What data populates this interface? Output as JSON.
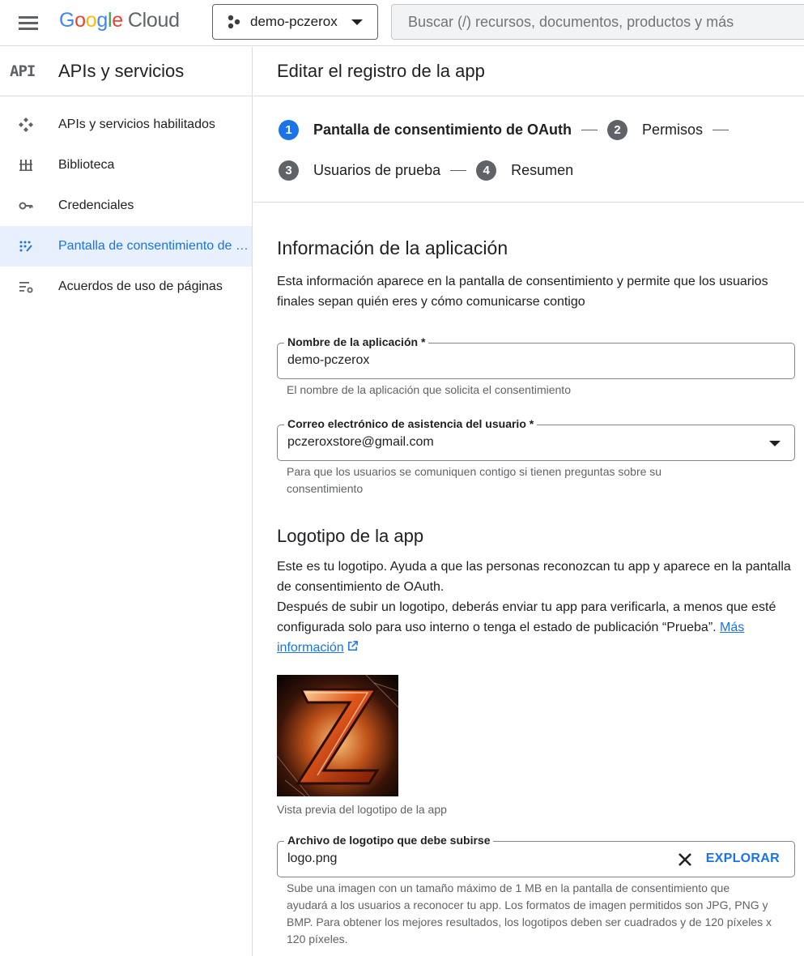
{
  "header": {
    "logo_text": "Google Cloud",
    "project_name": "demo-pczerox",
    "search_placeholder": "Buscar (/) recursos, documentos, productos y más"
  },
  "sidebar": {
    "badge": "API",
    "title": "APIs y servicios",
    "items": [
      {
        "label": "APIs y servicios habilitados",
        "icon": "apis-services-icon",
        "active": false
      },
      {
        "label": "Biblioteca",
        "icon": "library-icon",
        "active": false
      },
      {
        "label": "Credenciales",
        "icon": "key-icon",
        "active": false
      },
      {
        "label": "Pantalla de consentimiento de OAuth",
        "icon": "consent-screen-icon",
        "active": true
      },
      {
        "label": "Acuerdos de uso de páginas",
        "icon": "page-usage-settings-icon",
        "active": false
      }
    ]
  },
  "main": {
    "page_title": "Editar el registro de la app",
    "steps": [
      {
        "num": "1",
        "label": "Pantalla de consentimiento de OAuth",
        "active": true
      },
      {
        "num": "2",
        "label": "Permisos",
        "active": false
      },
      {
        "num": "3",
        "label": "Usuarios de prueba",
        "active": false
      },
      {
        "num": "4",
        "label": "Resumen",
        "active": false
      }
    ],
    "app_info": {
      "heading": "Información de la aplicación",
      "description": "Esta información aparece en la pantalla de consentimiento y permite que los usuarios finales sepan quién eres y cómo comunicarse contigo",
      "app_name_label": "Nombre de la aplicación *",
      "app_name_value": "demo-pczerox",
      "app_name_hint": "El nombre de la aplicación que solicita el consentimiento",
      "support_email_label": "Correo electrónico de asistencia del usuario *",
      "support_email_value": "pczeroxstore@gmail.com",
      "support_email_hint": "Para que los usuarios se comuniquen contigo si tienen preguntas sobre su consentimiento"
    },
    "logo_section": {
      "heading": "Logotipo de la app",
      "description_1": "Este es tu logotipo. Ayuda a que las personas reconozcan tu app y aparece en la pantalla de consentimiento de OAuth.",
      "description_2": "Después de subir un logotipo, deberás enviar tu app para verificarla, a menos que esté configurada solo para uso interno o tenga el estado de publicación “Prueba”.",
      "more_info_link": "Más información",
      "logo_letter": "Z",
      "preview_caption": "Vista previa del logotipo de la app",
      "file_label": "Archivo de logotipo que debe subirse",
      "file_value": "logo.png",
      "browse_button": "EXPLORAR",
      "file_hint": "Sube una imagen con un tamaño máximo de 1 MB en la pantalla de consentimiento que ayudará a los usuarios a reconocer tu app. Los formatos de imagen permitidos son JPG, PNG y BMP. Para obtener los mejores resultados, los logotipos deben ser cuadrados y de 120 píxeles x 120 píxeles."
    }
  },
  "colors": {
    "accent": "#1a73e8",
    "active_nav_bg": "#e8f0fe",
    "step_inactive": "#5f6368"
  }
}
